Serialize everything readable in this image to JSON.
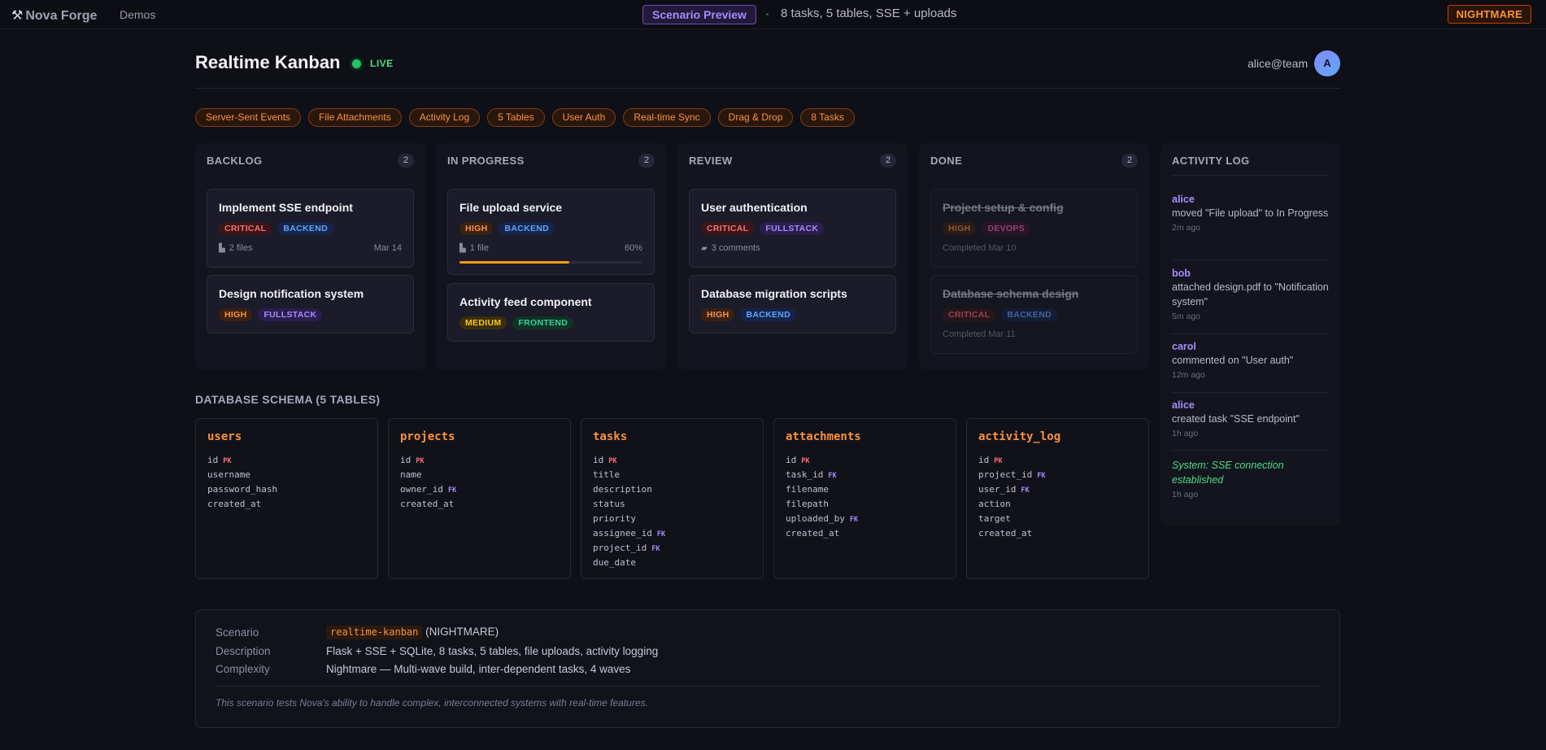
{
  "topbar": {
    "brand": "Nova Forge",
    "brand_icon": "hammer-wrench-icon",
    "nav_demos": "Demos",
    "scenario_pill": "Scenario Preview",
    "summary": "8 tasks, 5 tables, SSE + uploads",
    "difficulty": "NIGHTMARE"
  },
  "header": {
    "title": "Realtime Kanban",
    "live": "LIVE",
    "user_email": "alice@team",
    "avatar_initial": "A"
  },
  "tags": [
    "Server-Sent Events",
    "File Attachments",
    "Activity Log",
    "5 Tables",
    "User Auth",
    "Real-time Sync",
    "Drag & Drop",
    "8 Tasks"
  ],
  "columns": [
    {
      "title": "BACKLOG",
      "count": "2",
      "cards": [
        {
          "title": "Implement SSE endpoint",
          "badges": [
            {
              "text": "CRITICAL",
              "kind": "critical"
            },
            {
              "text": "BACKEND",
              "kind": "backend"
            }
          ],
          "meta": "2 files",
          "meta_icon": "folder-icon",
          "date": "Mar 14"
        },
        {
          "title": "Design notification system",
          "badges": [
            {
              "text": "HIGH",
              "kind": "high"
            },
            {
              "text": "FULLSTACK",
              "kind": "fullstack"
            }
          ]
        }
      ]
    },
    {
      "title": "IN PROGRESS",
      "count": "2",
      "cards": [
        {
          "title": "File upload service",
          "badges": [
            {
              "text": "HIGH",
              "kind": "high"
            },
            {
              "text": "BACKEND",
              "kind": "backend"
            }
          ],
          "meta": "1 file",
          "meta_icon": "folder-icon",
          "progress_label": "60%",
          "progress": 0.6
        },
        {
          "title": "Activity feed component",
          "badges": [
            {
              "text": "MEDIUM",
              "kind": "medium"
            },
            {
              "text": "FRONTEND",
              "kind": "frontend"
            }
          ]
        }
      ]
    },
    {
      "title": "REVIEW",
      "count": "2",
      "cards": [
        {
          "title": "User authentication",
          "badges": [
            {
              "text": "CRITICAL",
              "kind": "critical"
            },
            {
              "text": "FULLSTACK",
              "kind": "fullstack"
            }
          ],
          "meta": "3 comments",
          "meta_icon": "comment-icon"
        },
        {
          "title": "Database migration scripts",
          "badges": [
            {
              "text": "HIGH",
              "kind": "high"
            },
            {
              "text": "BACKEND",
              "kind": "backend"
            }
          ]
        }
      ]
    },
    {
      "title": "DONE",
      "count": "2",
      "cards": [
        {
          "title": "Project setup & config",
          "badges": [
            {
              "text": "HIGH",
              "kind": "high"
            },
            {
              "text": "DEVOPS",
              "kind": "devops"
            }
          ],
          "meta": "Completed Mar 10"
        },
        {
          "title": "Database schema design",
          "badges": [
            {
              "text": "CRITICAL",
              "kind": "critical"
            },
            {
              "text": "BACKEND",
              "kind": "backend"
            }
          ],
          "meta": "Completed Mar 11"
        }
      ]
    }
  ],
  "activity": {
    "title": "ACTIVITY LOG",
    "items": [
      {
        "user": "alice",
        "text": "moved \"File upload\" to In Progress",
        "time": "2m ago"
      },
      {
        "user": "bob",
        "text": "attached design.pdf to \"Notification system\"",
        "time": "5m ago"
      },
      {
        "user": "carol",
        "text": "commented on \"User auth\"",
        "time": "12m ago"
      },
      {
        "user": "alice",
        "text": "created task \"SSE endpoint\"",
        "time": "1h ago"
      }
    ],
    "system": {
      "text": "System: SSE connection established",
      "time": "1h ago"
    }
  },
  "schema": {
    "title": "DATABASE SCHEMA (5 TABLES)",
    "tables": [
      {
        "name": "users",
        "fields": [
          {
            "n": "id",
            "k": "PK"
          },
          {
            "n": "username"
          },
          {
            "n": "password_hash"
          },
          {
            "n": "created_at"
          }
        ]
      },
      {
        "name": "projects",
        "fields": [
          {
            "n": "id",
            "k": "PK"
          },
          {
            "n": "name"
          },
          {
            "n": "owner_id",
            "k": "FK"
          },
          {
            "n": "created_at"
          }
        ]
      },
      {
        "name": "tasks",
        "fields": [
          {
            "n": "id",
            "k": "PK"
          },
          {
            "n": "title"
          },
          {
            "n": "description"
          },
          {
            "n": "status"
          },
          {
            "n": "priority"
          },
          {
            "n": "assignee_id",
            "k": "FK"
          },
          {
            "n": "project_id",
            "k": "FK"
          },
          {
            "n": "due_date"
          }
        ]
      },
      {
        "name": "attachments",
        "fields": [
          {
            "n": "id",
            "k": "PK"
          },
          {
            "n": "task_id",
            "k": "FK"
          },
          {
            "n": "filename"
          },
          {
            "n": "filepath"
          },
          {
            "n": "uploaded_by",
            "k": "FK"
          },
          {
            "n": "created_at"
          }
        ]
      },
      {
        "name": "activity_log",
        "fields": [
          {
            "n": "id",
            "k": "PK"
          },
          {
            "n": "project_id",
            "k": "FK"
          },
          {
            "n": "user_id",
            "k": "FK"
          },
          {
            "n": "action"
          },
          {
            "n": "target"
          },
          {
            "n": "created_at"
          }
        ]
      }
    ]
  },
  "info": {
    "scenario_label": "Scenario",
    "scenario_code": "realtime-kanban",
    "scenario_suffix": "(NIGHTMARE)",
    "description_label": "Description",
    "description": "Flask + SSE + SQLite, 8 tasks, 5 tables, file uploads, activity logging",
    "complexity_label": "Complexity",
    "complexity": "Nightmare — Multi-wave build, inter-dependent tasks, 4 waves",
    "note": "This scenario tests Nova's ability to handle complex, interconnected systems with real-time features."
  }
}
